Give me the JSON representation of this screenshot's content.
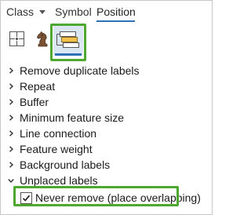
{
  "tabs": {
    "class_label": "Class",
    "symbol_label": "Symbol",
    "position_label": "Position",
    "active": "Position"
  },
  "toolbar": {
    "buttons": [
      {
        "icon": "placement-icon",
        "selected": false
      },
      {
        "icon": "conflict-resolution-icon",
        "selected": false
      },
      {
        "icon": "fitting-strategy-icon",
        "selected": true
      }
    ]
  },
  "properties": {
    "items": [
      {
        "label": "Remove duplicate labels",
        "expanded": false
      },
      {
        "label": "Repeat",
        "expanded": false
      },
      {
        "label": "Buffer",
        "expanded": false
      },
      {
        "label": "Minimum feature size",
        "expanded": false
      },
      {
        "label": "Line connection",
        "expanded": false
      },
      {
        "label": "Feature weight",
        "expanded": false
      },
      {
        "label": "Background labels",
        "expanded": false
      },
      {
        "label": "Unplaced labels",
        "expanded": true
      }
    ],
    "unplaced": {
      "checkbox_label": "Never remove (place overlapping)",
      "checked": true
    }
  },
  "colors": {
    "accent_blue": "#2f6fb7",
    "highlight_green": "#4ea72e",
    "selected_bg": "#dbe6f3"
  }
}
